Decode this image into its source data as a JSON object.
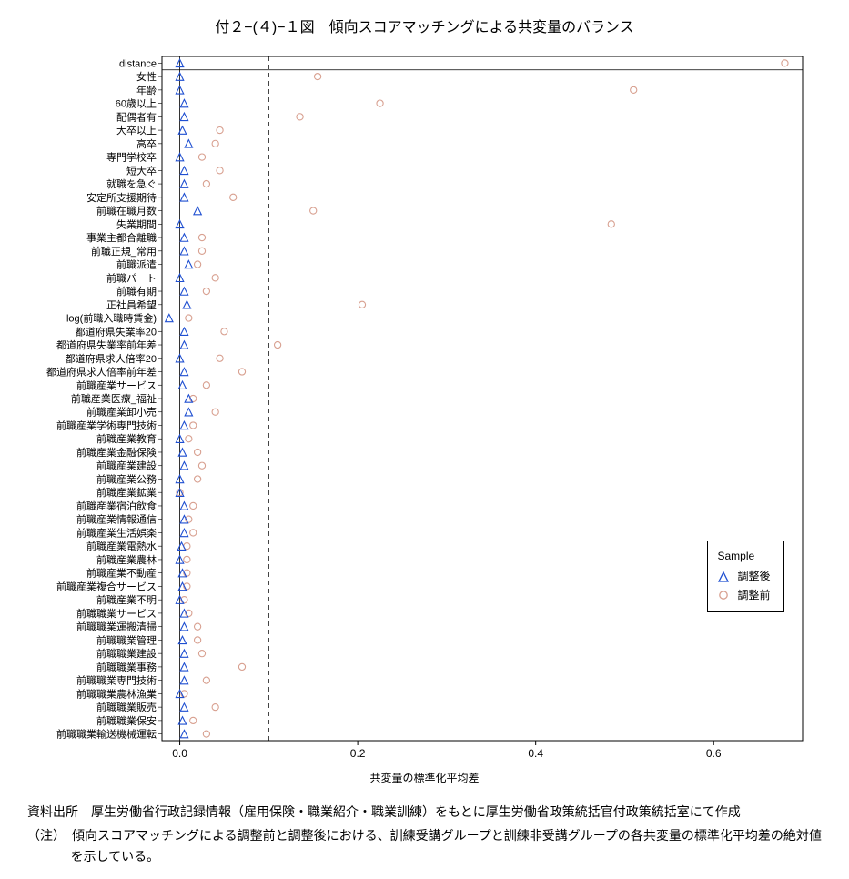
{
  "title": "付２−(４)−１図　傾向スコアマッチングによる共変量のバランス",
  "xlabel": "共変量の標準化平均差",
  "legend": {
    "title": "Sample",
    "adjusted": "調整後",
    "unadjusted": "調整前"
  },
  "notes": {
    "source": "資料出所　厚生労働省行政記録情報（雇用保険・職業紹介・職業訓練）をもとに厚生労働省政策統括官付政策統括室にて作成",
    "note": "（注）　傾向スコアマッチングによる調整前と調整後における、訓練受講グループと訓練非受講グループの各共変量の標準化平均差の絶対値を示している。"
  },
  "chart_data": {
    "type": "scatter",
    "xlabel": "共変量の標準化平均差",
    "ylabel": "",
    "xlim": [
      -0.02,
      0.7
    ],
    "x_ticks": [
      0.0,
      0.2,
      0.4,
      0.6
    ],
    "ref_line": 0.1,
    "series": [
      {
        "name": "調整後",
        "marker": "triangle-open",
        "color": "#1f4fd1"
      },
      {
        "name": "調整前",
        "marker": "circle-open",
        "color": "#d8a090"
      }
    ],
    "rows": [
      {
        "label": "distance",
        "adjusted": 0.0,
        "unadjusted": 0.68
      },
      {
        "label": "女性",
        "adjusted": 0.0,
        "unadjusted": 0.155
      },
      {
        "label": "年齢",
        "adjusted": 0.0,
        "unadjusted": 0.51
      },
      {
        "label": "60歳以上",
        "adjusted": 0.005,
        "unadjusted": 0.225
      },
      {
        "label": "配偶者有",
        "adjusted": 0.005,
        "unadjusted": 0.135
      },
      {
        "label": "大卒以上",
        "adjusted": 0.003,
        "unadjusted": 0.045
      },
      {
        "label": "高卒",
        "adjusted": 0.01,
        "unadjusted": 0.04
      },
      {
        "label": "専門学校卒",
        "adjusted": 0.0,
        "unadjusted": 0.025
      },
      {
        "label": "短大卒",
        "adjusted": 0.005,
        "unadjusted": 0.045
      },
      {
        "label": "就職を急ぐ",
        "adjusted": 0.005,
        "unadjusted": 0.03
      },
      {
        "label": "安定所支援期待",
        "adjusted": 0.005,
        "unadjusted": 0.06
      },
      {
        "label": "前職在職月数",
        "adjusted": 0.02,
        "unadjusted": 0.15
      },
      {
        "label": "失業期間",
        "adjusted": 0.0,
        "unadjusted": 0.485
      },
      {
        "label": "事業主都合離職",
        "adjusted": 0.005,
        "unadjusted": 0.025
      },
      {
        "label": "前職正規_常用",
        "adjusted": 0.005,
        "unadjusted": 0.025
      },
      {
        "label": "前職派遣",
        "adjusted": 0.01,
        "unadjusted": 0.02
      },
      {
        "label": "前職パート",
        "adjusted": 0.0,
        "unadjusted": 0.04
      },
      {
        "label": "前職有期",
        "adjusted": 0.005,
        "unadjusted": 0.03
      },
      {
        "label": "正社員希望",
        "adjusted": 0.008,
        "unadjusted": 0.205
      },
      {
        "label": "log(前職入職時賃金)",
        "adjusted": -0.012,
        "unadjusted": 0.01
      },
      {
        "label": "都道府県失業率20",
        "adjusted": 0.005,
        "unadjusted": 0.05
      },
      {
        "label": "都道府県失業率前年差",
        "adjusted": 0.005,
        "unadjusted": 0.11
      },
      {
        "label": "都道府県求人倍率20",
        "adjusted": 0.0,
        "unadjusted": 0.045
      },
      {
        "label": "都道府県求人倍率前年差",
        "adjusted": 0.005,
        "unadjusted": 0.07
      },
      {
        "label": "前職産業サービス",
        "adjusted": 0.003,
        "unadjusted": 0.03
      },
      {
        "label": "前職産業医療_福祉",
        "adjusted": 0.01,
        "unadjusted": 0.015
      },
      {
        "label": "前職産業卸小売",
        "adjusted": 0.01,
        "unadjusted": 0.04
      },
      {
        "label": "前職産業学術専門技術",
        "adjusted": 0.005,
        "unadjusted": 0.015
      },
      {
        "label": "前職産業教育",
        "adjusted": 0.0,
        "unadjusted": 0.01
      },
      {
        "label": "前職産業金融保険",
        "adjusted": 0.003,
        "unadjusted": 0.02
      },
      {
        "label": "前職産業建設",
        "adjusted": 0.005,
        "unadjusted": 0.025
      },
      {
        "label": "前職産業公務",
        "adjusted": 0.0,
        "unadjusted": 0.02
      },
      {
        "label": "前職産業鉱業",
        "adjusted": 0.0,
        "unadjusted": 0.0
      },
      {
        "label": "前職産業宿泊飲食",
        "adjusted": 0.005,
        "unadjusted": 0.015
      },
      {
        "label": "前職産業情報通信",
        "adjusted": 0.005,
        "unadjusted": 0.01
      },
      {
        "label": "前職産業生活娯楽",
        "adjusted": 0.005,
        "unadjusted": 0.015
      },
      {
        "label": "前職産業電熱水",
        "adjusted": 0.002,
        "unadjusted": 0.008
      },
      {
        "label": "前職産業農林",
        "adjusted": 0.0,
        "unadjusted": 0.008
      },
      {
        "label": "前職産業不動産",
        "adjusted": 0.003,
        "unadjusted": 0.008
      },
      {
        "label": "前職産業複合サービス",
        "adjusted": 0.003,
        "unadjusted": 0.008
      },
      {
        "label": "前職産業不明",
        "adjusted": 0.0,
        "unadjusted": 0.005
      },
      {
        "label": "前職職業サービス",
        "adjusted": 0.005,
        "unadjusted": 0.01
      },
      {
        "label": "前職職業運搬清掃",
        "adjusted": 0.005,
        "unadjusted": 0.02
      },
      {
        "label": "前職職業管理",
        "adjusted": 0.003,
        "unadjusted": 0.02
      },
      {
        "label": "前職職業建設",
        "adjusted": 0.005,
        "unadjusted": 0.025
      },
      {
        "label": "前職職業事務",
        "adjusted": 0.005,
        "unadjusted": 0.07
      },
      {
        "label": "前職職業専門技術",
        "adjusted": 0.005,
        "unadjusted": 0.03
      },
      {
        "label": "前職職業農林漁業",
        "adjusted": 0.0,
        "unadjusted": 0.005
      },
      {
        "label": "前職職業販売",
        "adjusted": 0.005,
        "unadjusted": 0.04
      },
      {
        "label": "前職職業保安",
        "adjusted": 0.003,
        "unadjusted": 0.015
      },
      {
        "label": "前職職業輸送機械運転",
        "adjusted": 0.005,
        "unadjusted": 0.03
      }
    ]
  }
}
